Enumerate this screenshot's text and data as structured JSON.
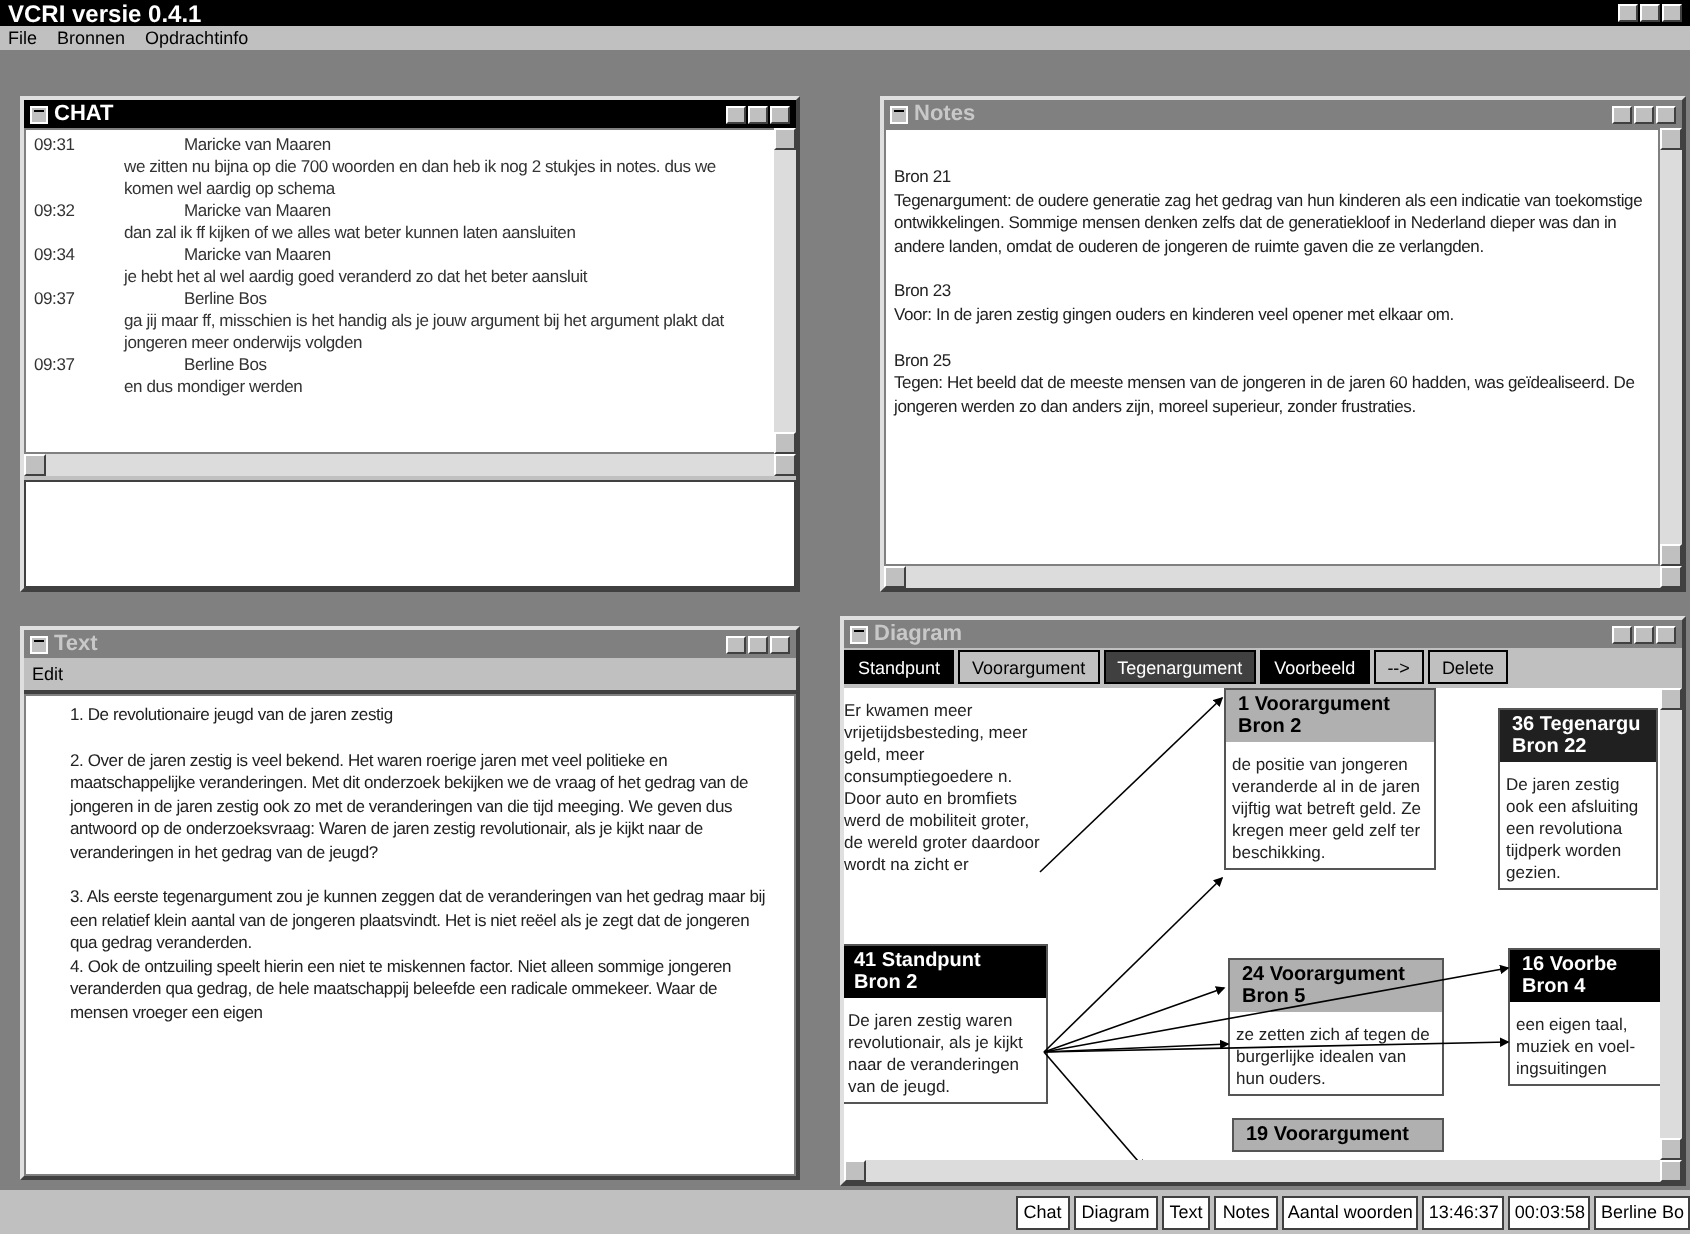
{
  "app": {
    "title": "VCRI versie 0.4.1",
    "menu": [
      "File",
      "Bronnen",
      "Opdrachtinfo"
    ]
  },
  "chat": {
    "title": "CHAT",
    "active": true,
    "messages": [
      {
        "time": "09:31",
        "author": "Maricke van Maaren",
        "text": "we zitten nu bijna op die 700 woorden en dan heb ik nog 2 stukjes in notes. dus we komen wel aardig op schema"
      },
      {
        "time": "09:32",
        "author": "Maricke van Maaren",
        "text": "dan zal ik ff kijken of we alles wat beter kunnen laten aansluiten"
      },
      {
        "time": "09:34",
        "author": "Maricke van Maaren",
        "text": "je hebt het al wel aardig goed veranderd zo dat het beter aansluit"
      },
      {
        "time": "09:37",
        "author": "Berline Bos",
        "text": "ga jij maar ff, misschien is het handig als je jouw argument bij het argument plakt dat jongeren meer onderwijs volgden"
      },
      {
        "time": "09:37",
        "author": "Berline Bos",
        "text": "en dus mondiger werden"
      }
    ]
  },
  "notes": {
    "title": "Notes",
    "active": false,
    "entries": [
      {
        "source": "Bron 21",
        "text": "Tegenargument: de oudere generatie zag het gedrag van hun kinderen als een indicatie van toekomstige ontwikkelingen. Sommige mensen denken zelfs dat de generatiekloof in Nederland dieper was dan in andere landen, omdat de ouderen de jongeren de ruimte gaven die ze verlangden."
      },
      {
        "source": "Bron 23",
        "text": "Voor: In de jaren zestig gingen ouders en kinderen veel opener met elkaar om."
      },
      {
        "source": "Bron 25",
        "text": "Tegen: Het beeld dat de meeste mensen van de jongeren in de jaren 60 hadden, was geïdealiseerd. De jongeren werden zo dan anders zijn, moreel superieur, zonder frustraties."
      }
    ]
  },
  "text": {
    "title": "Text",
    "active": false,
    "menu": [
      "Edit"
    ],
    "sections": [
      {
        "paragraphs": [
          "1. De revolutionaire jeugd van de jaren zestig"
        ]
      },
      {
        "paragraphs": [
          "2. Over de jaren zestig is veel bekend. Het waren roerige jaren met veel politieke en maatschappelijke veranderingen. Met dit onderzoek bekijken we de vraag of het gedrag van de jongeren in de jaren zestig ook zo met de veranderingen van die tijd meeging. We geven dus antwoord op de onderzoeksvraag: Waren de jaren zestig revolutionair, als je kijkt naar de veranderingen in het gedrag van de jeugd?"
        ]
      },
      {
        "paragraphs": [
          "3. Als eerste tegenargument zou je kunnen zeggen dat de veranderingen van het gedrag maar bij een relatief klein aantal van de jongeren plaatsvindt. Het is niet reëel als je zegt dat de jongeren qua gedrag veranderden.",
          "4. Ook de ontzuiling speelt hierin een niet te miskennen factor. Niet alleen sommige jongeren veranderden qua gedrag, de hele maatschappij beleefde een radicale ommekeer. Waar de mensen vroeger een eigen"
        ]
      }
    ]
  },
  "diagram": {
    "title": "Diagram",
    "active": false,
    "tools": [
      {
        "label": "Standpunt",
        "color": "#000000"
      },
      {
        "label": "Voorargument",
        "color": "#c0c0c0"
      },
      {
        "label": "Tegenargument",
        "color": "#404040"
      },
      {
        "label": "Voorbeeld",
        "color": "#000000"
      },
      {
        "label": "-->",
        "color": "#c0c0c0"
      },
      {
        "label": "Delete",
        "color": "#c0c0c0"
      }
    ],
    "nodes": [
      {
        "kind": "loose",
        "body": "Er kwamen meer vrijetijdsbesteding, meer geld, meer consumptiegoedere n. Door auto en bromfiets werd de mobiliteit groter, de wereld groter daardoor wordt na zicht er"
      },
      {
        "kind": "standpunt",
        "title": "41 Standpunt",
        "source": "Bron 2",
        "body": "De jaren zestig waren revolutionair, als je kijkt naar de veranderingen van de jeugd."
      },
      {
        "kind": "voorargument",
        "title": "1 Voorargument",
        "source": "Bron 2",
        "body": "de positie van jongeren veranderde al in de jaren vijftig wat betreft geld. Ze kregen meer geld zelf ter beschikking."
      },
      {
        "kind": "voorargument",
        "title": "24 Voorargument",
        "source": "Bron 5",
        "body": "ze zetten zich af tegen de burgerlijke idealen van hun ouders."
      },
      {
        "kind": "voorargument",
        "title": "19 Voorargument"
      },
      {
        "kind": "tegenargument",
        "title": "36 Tegenargu",
        "source": "Bron 22",
        "body": "De jaren zestig ook een afsluiting een revolutiona tijdperk worden gezien."
      },
      {
        "kind": "voorbeeld",
        "title": "16 Voorbe",
        "source": "Bron 4",
        "body": "een eigen taal, muziek en voel- ingsuitingen"
      }
    ]
  },
  "status_bar": {
    "buttons": [
      "Chat",
      "Diagram",
      "Text",
      "Notes"
    ],
    "fields": [
      "Aantal woorden",
      "13:46:37",
      "00:03:58",
      "Berline Bo"
    ]
  }
}
